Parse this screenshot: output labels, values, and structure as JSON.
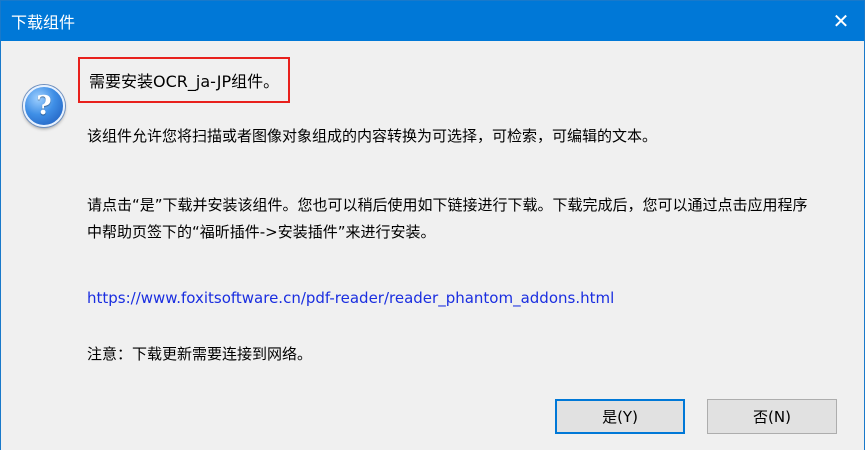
{
  "window": {
    "title": "下载组件",
    "close_glyph": "✕"
  },
  "icon": {
    "name": "question-icon",
    "glyph": "?"
  },
  "message": {
    "headline": "需要安装OCR_ja-JP组件。",
    "paragraph1": "该组件允许您将扫描或者图像对象组成的内容转换为可选择，可检索，可编辑的文本。",
    "paragraph2": "请点击“是”下载并安装该组件。您也可以稍后使用如下链接进行下载。下载完成后，您可以通过点击应用程序中帮助页签下的“福昕插件->安装插件”来进行安装。",
    "link": "https://www.foxitsoftware.cn/pdf-reader/reader_phantom_addons.html",
    "note": "注意：下载更新需要连接到网络。"
  },
  "buttons": {
    "yes_label": "是(Y)",
    "no_label": "否(N)"
  },
  "colors": {
    "titlebar": "#0078d7",
    "highlight_border": "#e8201c",
    "link": "#1a2ee0"
  }
}
